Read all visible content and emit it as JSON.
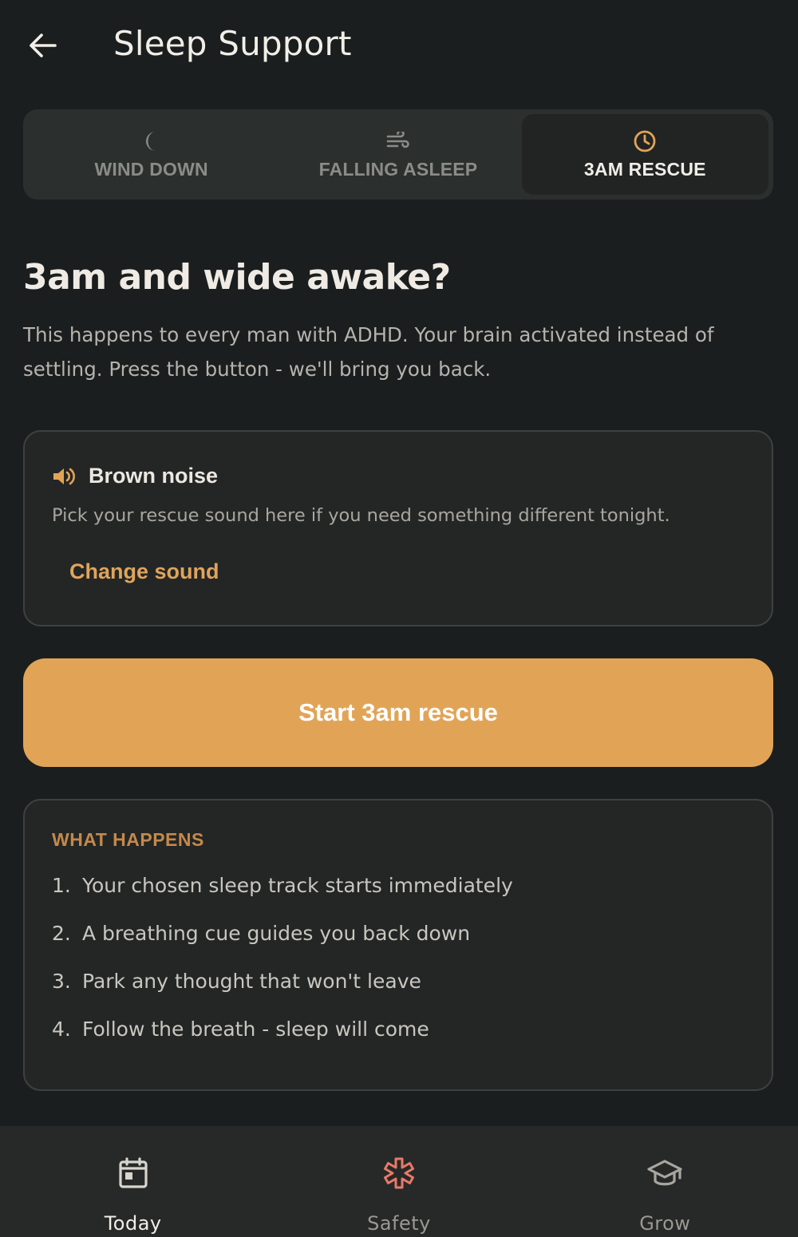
{
  "header": {
    "title": "Sleep Support",
    "back_icon": "arrow-left-icon"
  },
  "tabs": [
    {
      "label": "WIND DOWN",
      "icon": "moon-icon",
      "active": false
    },
    {
      "label": "FALLING ASLEEP",
      "icon": "wind-icon",
      "active": false
    },
    {
      "label": "3AM RESCUE",
      "icon": "clock-icon",
      "active": true
    }
  ],
  "main": {
    "headline": "3am and wide awake?",
    "intro": "This happens to every man with ADHD. Your brain activated instead of settling. Press the button - we'll bring you back."
  },
  "sound_card": {
    "icon": "speaker-icon",
    "name": "Brown noise",
    "description": "Pick your rescue sound here if you need something different tonight.",
    "change_label": "Change sound"
  },
  "cta": {
    "label": "Start 3am rescue"
  },
  "steps": {
    "title": "WHAT HAPPENS",
    "items": [
      {
        "num": "1.",
        "text": "Your chosen sleep track starts immediately"
      },
      {
        "num": "2.",
        "text": "A breathing cue guides you back down"
      },
      {
        "num": "3.",
        "text": "Park any thought that won't leave"
      },
      {
        "num": "4.",
        "text": "Follow the breath - sleep will come"
      }
    ]
  },
  "bottom_nav": [
    {
      "label": "Today",
      "icon": "calendar-icon",
      "active": true
    },
    {
      "label": "Safety",
      "icon": "asterisk-icon",
      "active": false
    },
    {
      "label": "Grow",
      "icon": "graduation-cap-icon",
      "active": false
    }
  ],
  "colors": {
    "background": "#1b1e1e",
    "accent": "#e1a457",
    "section_title": "#c4894a",
    "safety_icon": "#e8796a"
  }
}
